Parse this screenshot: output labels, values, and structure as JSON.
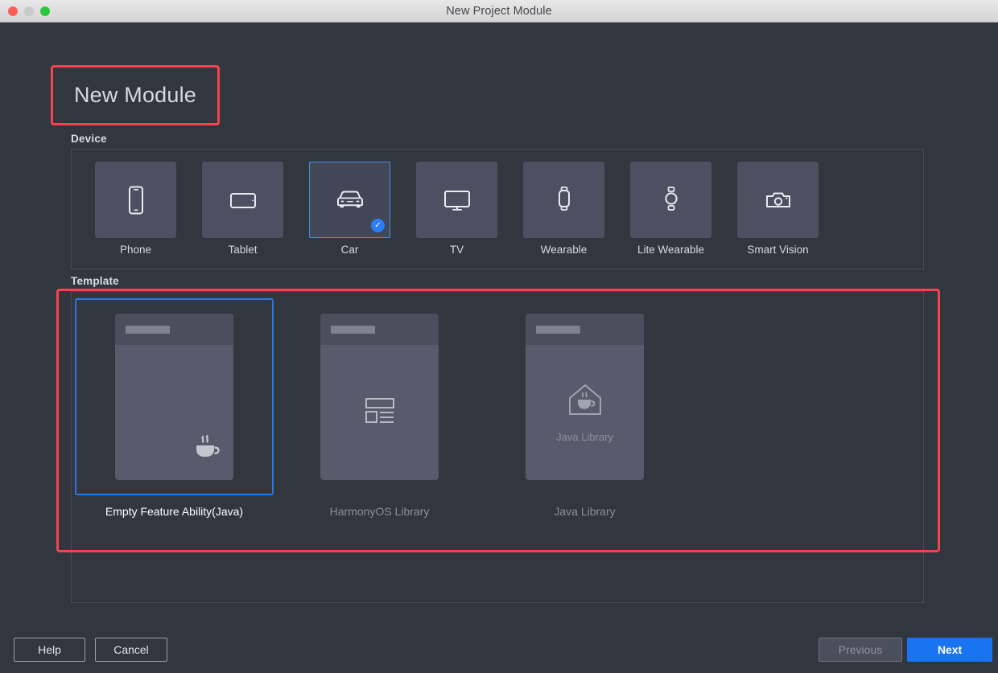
{
  "window": {
    "title": "New Project Module",
    "traffic_lights": [
      "close",
      "minimize",
      "maximize"
    ]
  },
  "heading": {
    "title": "New Module",
    "highlight_color": "#f8434e"
  },
  "sections": {
    "device_label": "Device",
    "template_label": "Template"
  },
  "devices": {
    "selected": "Car",
    "items": [
      {
        "label": "Phone",
        "icon": "phone-icon",
        "selected": false
      },
      {
        "label": "Tablet",
        "icon": "tablet-icon",
        "selected": false
      },
      {
        "label": "Car",
        "icon": "car-icon",
        "selected": true
      },
      {
        "label": "TV",
        "icon": "tv-icon",
        "selected": false
      },
      {
        "label": "Wearable",
        "icon": "watch-square-icon",
        "selected": false
      },
      {
        "label": "Lite Wearable",
        "icon": "watch-round-icon",
        "selected": false
      },
      {
        "label": "Smart Vision",
        "icon": "camera-icon",
        "selected": false
      }
    ]
  },
  "templates": {
    "selected": "Empty Feature Ability(Java)",
    "items": [
      {
        "label": "Empty Feature Ability(Java)",
        "icon": "coffee-cup-icon",
        "caption": "",
        "selected": true
      },
      {
        "label": "HarmonyOS Library",
        "icon": "layout-list-icon",
        "caption": "",
        "selected": false
      },
      {
        "label": "Java Library",
        "icon": "java-house-icon",
        "caption": "Java Library",
        "selected": false
      }
    ]
  },
  "footer": {
    "help_label": "Help",
    "cancel_label": "Cancel",
    "previous_label": "Previous",
    "next_label": "Next",
    "next_color": "#1874f0"
  }
}
